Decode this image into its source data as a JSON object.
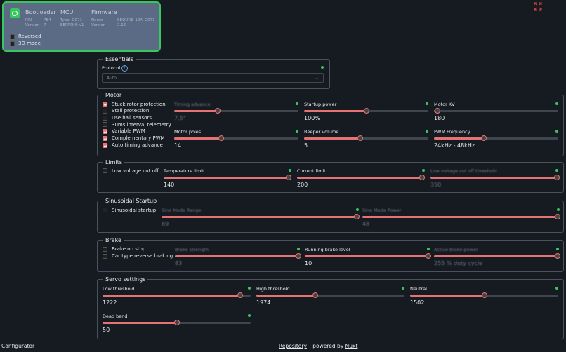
{
  "device_card": {
    "bootloader": {
      "title": "Bootloader",
      "row1_key": "PIN",
      "row1_val": "PB4",
      "row2_key": "Version",
      "row2_val": "7"
    },
    "mcu": {
      "title": "MCU",
      "row1_key": "Type",
      "row1_val": "G071",
      "row2_key": "EEPROM",
      "row2_val": "v1"
    },
    "firmware": {
      "title": "Firmware",
      "row1_key": "Name",
      "row1_val": "SEQURE_12A_G071",
      "row2_key": "Version",
      "row2_val": "2.16"
    },
    "options": [
      {
        "label": "Reversed",
        "checked": false
      },
      {
        "label": "3D mode",
        "checked": false
      }
    ]
  },
  "essentials": {
    "title": "Essentials",
    "protocol_label": "Protocol",
    "protocol_value": "Auto",
    "help": "?"
  },
  "motor": {
    "title": "Motor",
    "checks": [
      {
        "label": "Stuck rotor protection",
        "checked": true
      },
      {
        "label": "Stall protection",
        "checked": false
      },
      {
        "label": "Use hall sensors",
        "checked": false
      },
      {
        "label": "30ms interval telemetry",
        "checked": false
      },
      {
        "label": "Variable PWM",
        "checked": true
      },
      {
        "label": "Complementary PWM",
        "checked": true
      },
      {
        "label": "Auto timing advance",
        "checked": true
      }
    ],
    "sliders": [
      {
        "label": "Timing advance",
        "value": "7.5°",
        "fraction": 0.35,
        "disabled": true
      },
      {
        "label": "Startup power",
        "value": "100%",
        "fraction": 0.5,
        "disabled": false
      },
      {
        "label": "Motor KV",
        "value": "180",
        "fraction": 0.03,
        "disabled": false
      },
      {
        "label": "Motor poles",
        "value": "14",
        "fraction": 0.38,
        "disabled": false
      },
      {
        "label": "Beeper volume",
        "value": "5",
        "fraction": 0.45,
        "disabled": false
      },
      {
        "label": "PWM Frequency",
        "value": "24kHz - 48kHz",
        "fraction": 0.4,
        "disabled": false
      }
    ]
  },
  "limits": {
    "title": "Limits",
    "checks": [
      {
        "label": "Low voltage cut off",
        "checked": false
      }
    ],
    "sliders": [
      {
        "label": "Temperature limit",
        "value": "140",
        "fraction": 0.98,
        "disabled": false
      },
      {
        "label": "Current limit",
        "value": "200",
        "fraction": 0.98,
        "disabled": false
      },
      {
        "label": "Low voltage cut off threshold",
        "value": "350",
        "fraction": 0.99,
        "disabled": true
      }
    ]
  },
  "sine": {
    "title": "Sinusoidal Startup",
    "checks": [
      {
        "label": "Sinusoidal startup",
        "checked": false
      }
    ],
    "sliders": [
      {
        "label": "Sine Mode Range",
        "value": "69",
        "fraction": 0.99,
        "disabled": true
      },
      {
        "label": "Sine Mode Power",
        "value": "48",
        "fraction": 0.99,
        "disabled": true
      }
    ]
  },
  "brake": {
    "title": "Brake",
    "checks": [
      {
        "label": "Brake on stop",
        "checked": false
      },
      {
        "label": "Car type reverse braking",
        "checked": false
      }
    ],
    "sliders": [
      {
        "label": "Brake strength",
        "value": "83",
        "fraction": 0.99,
        "disabled": true
      },
      {
        "label": "Running brake level",
        "value": "10",
        "fraction": 0.99,
        "disabled": false
      },
      {
        "label": "Active brake power",
        "value": "255 % duty cycle",
        "fraction": 0.99,
        "disabled": true
      }
    ]
  },
  "servo": {
    "title": "Servo settings",
    "sliders": [
      {
        "label": "Low threshold",
        "value": "1222",
        "fraction": 0.93,
        "disabled": false
      },
      {
        "label": "High threshold",
        "value": "1974",
        "fraction": 0.4,
        "disabled": false
      },
      {
        "label": "Neutral",
        "value": "1502",
        "fraction": 0.5,
        "disabled": false
      },
      {
        "label": "Dead band",
        "value": "50",
        "fraction": 0.5,
        "disabled": false
      }
    ]
  },
  "footer": {
    "left": "Configurator",
    "repo": "Repository",
    "powered": "powered by",
    "nuxt": "Nuxt"
  },
  "colors": {
    "accent": "#e57373",
    "ok": "#36c85a",
    "card": "#5c6b85"
  },
  "icons": {
    "power": "power-icon",
    "expand": "expand-icon",
    "help": "help-icon"
  }
}
